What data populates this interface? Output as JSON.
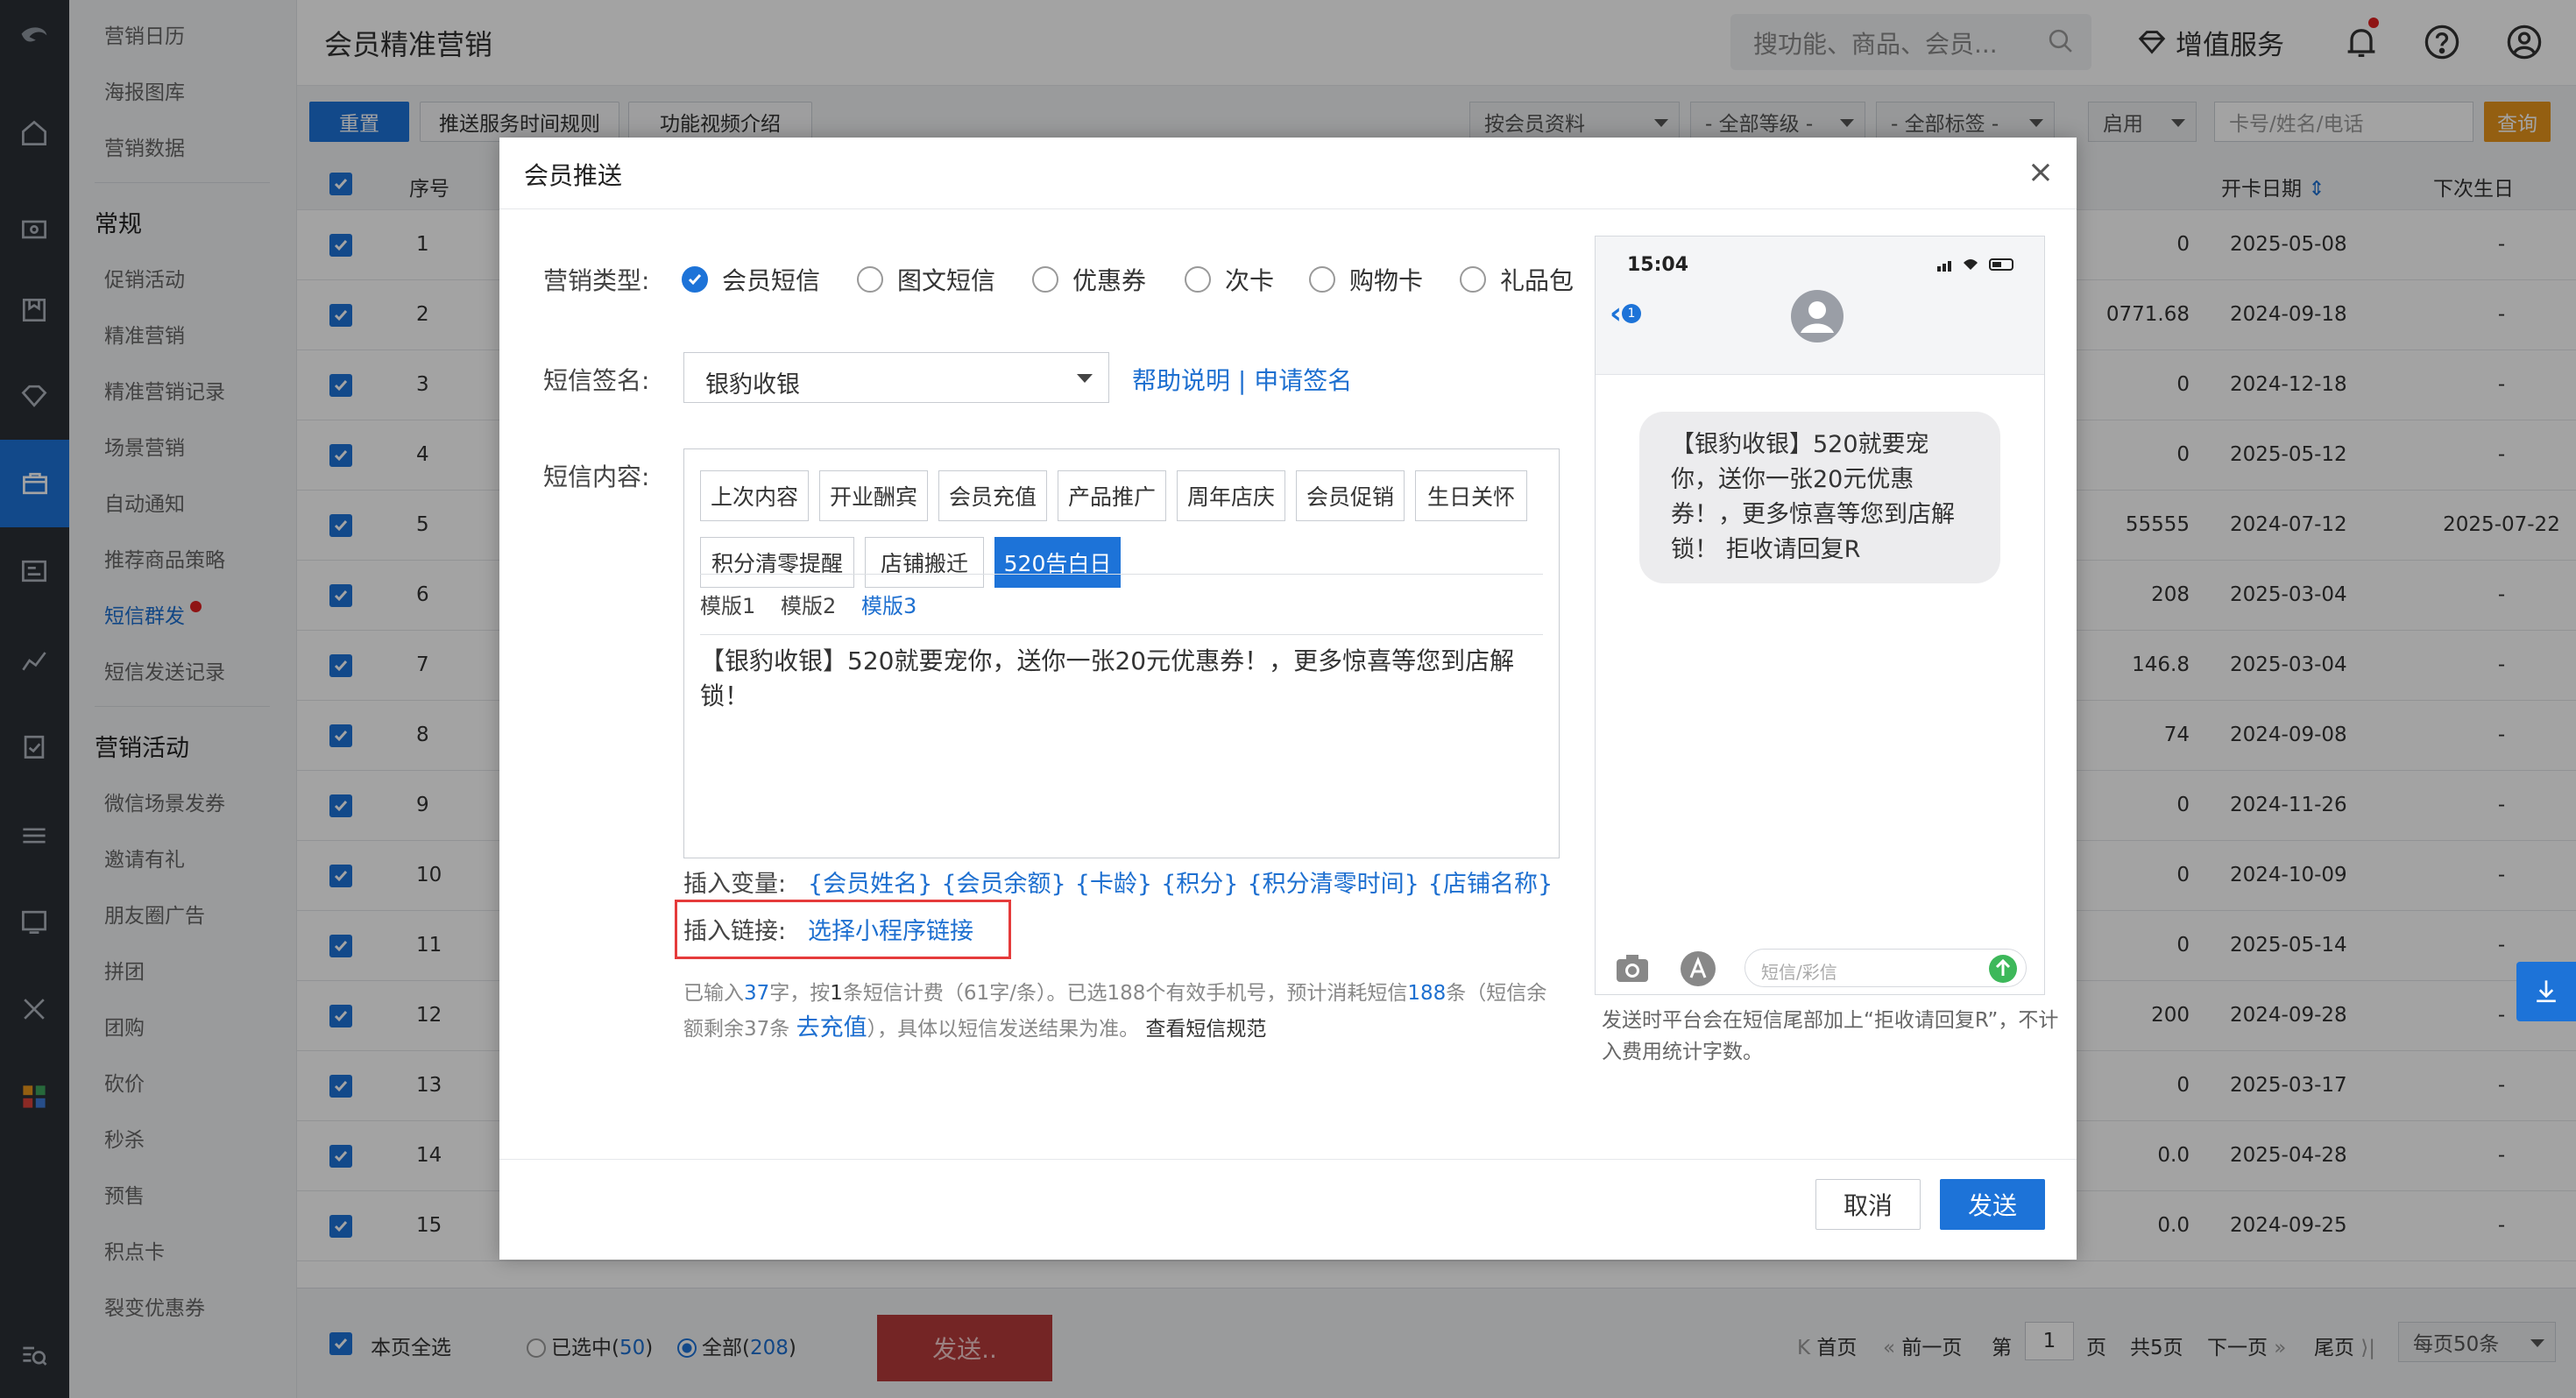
{
  "page_title": "会员精准营销",
  "search": {
    "placeholder": "搜功能、商品、会员..."
  },
  "header": {
    "value_service": "增值服务"
  },
  "nav": {
    "top_items": [
      "营销日历",
      "海报图库",
      "营销数据"
    ],
    "section1": "常规",
    "items1": [
      "促销活动",
      "精准营销",
      "精准营销记录",
      "场景营销",
      "自动通知",
      "推荐商品策略",
      "短信群发",
      "短信发送记录"
    ],
    "section2": "营销活动",
    "items2": [
      "微信场景发券",
      "邀请有礼",
      "朋友圈广告",
      "拼团",
      "团购",
      "砍价",
      "秒杀",
      "预售",
      "积点卡",
      "裂变优惠券"
    ]
  },
  "toolbar": {
    "reset": "重置",
    "rules": "推送服务时间规则",
    "video": "功能视频介绍",
    "filter1": "按会员资料",
    "filter2": "- 全部等级 -",
    "filter3": "- 全部标签 -",
    "filter4": "启用",
    "search_placeholder": "卡号/姓名/电话",
    "query": "查询"
  },
  "table": {
    "headers": {
      "seq": "序号",
      "open_date": "开卡日期",
      "next_birthday": "下次生日"
    },
    "rows": [
      {
        "seq": "1",
        "amount": "0",
        "open": "2025-05-08",
        "birthday": "-"
      },
      {
        "seq": "2",
        "amount": "0771.68",
        "open": "2024-09-18",
        "birthday": "-"
      },
      {
        "seq": "3",
        "amount": "0",
        "open": "2024-12-18",
        "birthday": "-"
      },
      {
        "seq": "4",
        "amount": "0",
        "open": "2025-05-12",
        "birthday": "-"
      },
      {
        "seq": "5",
        "amount": "55555",
        "open": "2024-07-12",
        "birthday": "2025-07-22"
      },
      {
        "seq": "6",
        "amount": "208",
        "open": "2025-03-04",
        "birthday": "-"
      },
      {
        "seq": "7",
        "amount": "146.8",
        "open": "2025-03-04",
        "birthday": "-"
      },
      {
        "seq": "8",
        "amount": "74",
        "open": "2024-09-08",
        "birthday": "-"
      },
      {
        "seq": "9",
        "amount": "0",
        "open": "2024-11-26",
        "birthday": "-"
      },
      {
        "seq": "10",
        "amount": "0",
        "open": "2024-10-09",
        "birthday": "-"
      },
      {
        "seq": "11",
        "amount": "0",
        "open": "2025-05-14",
        "birthday": "-"
      },
      {
        "seq": "12",
        "amount": "200",
        "open": "2024-09-28",
        "birthday": "-"
      },
      {
        "seq": "13",
        "amount": "0",
        "open": "2025-03-17",
        "birthday": "-"
      },
      {
        "seq": "14",
        "amount": "0.0",
        "open": "2025-04-28",
        "birthday": "-"
      },
      {
        "seq": "15",
        "amount": "0.0",
        "open": "2024-09-25",
        "birthday": "-"
      }
    ]
  },
  "footer": {
    "select_page": "本页全选",
    "selected": "已选中(",
    "selected_count": "50",
    "all": "全部(",
    "all_count": "208",
    "close_paren": ")",
    "send": "发送..",
    "first": "首页",
    "prev": "前一页",
    "page_label": "第",
    "page_num": "1",
    "page_unit": "页",
    "total_pages": "共5页",
    "next": "下一页",
    "last": "尾页",
    "per_page": "每页50条"
  },
  "modal": {
    "title": "会员推送",
    "type_label": "营销类型:",
    "types": [
      "会员短信",
      "图文短信",
      "优惠券",
      "次卡",
      "购物卡",
      "礼品包"
    ],
    "sign_label": "短信签名:",
    "sign_value": "银豹收银",
    "help_link": "帮助说明 | 申请签名",
    "content_label": "短信内容:",
    "tags": [
      "上次内容",
      "开业酬宾",
      "会员充值",
      "产品推广",
      "周年店庆",
      "会员促销",
      "生日关怀",
      "积分清零提醒",
      "店铺搬迁",
      "520告白日"
    ],
    "templates": [
      "模版1",
      "模版2",
      "模版3"
    ],
    "content": "【银豹收银】520就要宠你，送你一张20元优惠券！，更多惊喜等您到店解锁！",
    "insert_var_label": "插入变量:",
    "variables": [
      "{会员姓名}",
      "{会员余额}",
      "{卡龄}",
      "{积分}",
      "{积分清零时间}",
      "{店铺名称}"
    ],
    "insert_link_label": "插入链接:",
    "insert_link": "选择小程序链接",
    "note": {
      "p1": "已输入",
      "chars": "37",
      "p2": "字，按",
      "count": "1",
      "p3": "条短信计费（61字/条）。已选188个有效手机号，预计消耗短信",
      "total": "188",
      "p4": "条（短信余额剩余37条",
      "recharge": "去充值",
      "p5": "），具体以短信发送结果为准。",
      "rules": "查看短信规范"
    },
    "phone": {
      "time": "15:04",
      "back_badge": "1",
      "bubble": "【银豹收银】520就要宠你，送你一张20元优惠券！，更多惊喜等您到店解锁！ 拒收请回复R",
      "input_placeholder": "短信/彩信"
    },
    "phone_note": "发送时平台会在短信尾部加上“拒收请回复R”，不计入费用统计字数。",
    "cancel": "取消",
    "send": "发送"
  }
}
